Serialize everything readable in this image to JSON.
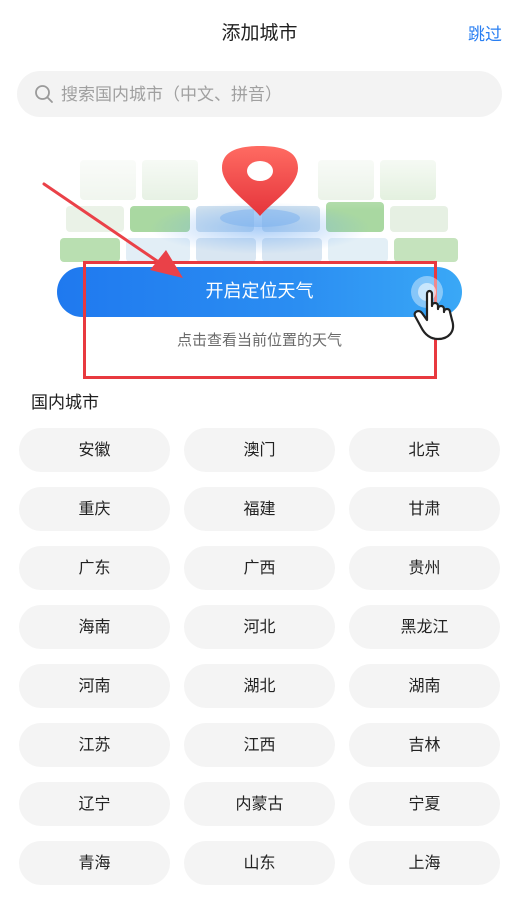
{
  "header": {
    "title": "添加城市",
    "skip_label": "跳过"
  },
  "search": {
    "placeholder": "搜索国内城市（中文、拼音）",
    "icon": "search-icon"
  },
  "locate": {
    "button_label": "开启定位天气",
    "subtext": "点击查看当前位置的天气",
    "pin_icon": "location-pin-icon",
    "hand_icon": "pointing-hand-icon"
  },
  "section": {
    "label": "国内城市"
  },
  "cities": [
    "安徽",
    "澳门",
    "北京",
    "重庆",
    "福建",
    "甘肃",
    "广东",
    "广西",
    "贵州",
    "海南",
    "河北",
    "黑龙江",
    "河南",
    "湖北",
    "湖南",
    "江苏",
    "江西",
    "吉林",
    "辽宁",
    "内蒙古",
    "宁夏",
    "青海",
    "山东",
    "上海"
  ],
  "colors": {
    "accent": "#2a7ff2",
    "button": "#1f79ef",
    "highlight": "#e8393f",
    "pin": "#f0474a"
  }
}
